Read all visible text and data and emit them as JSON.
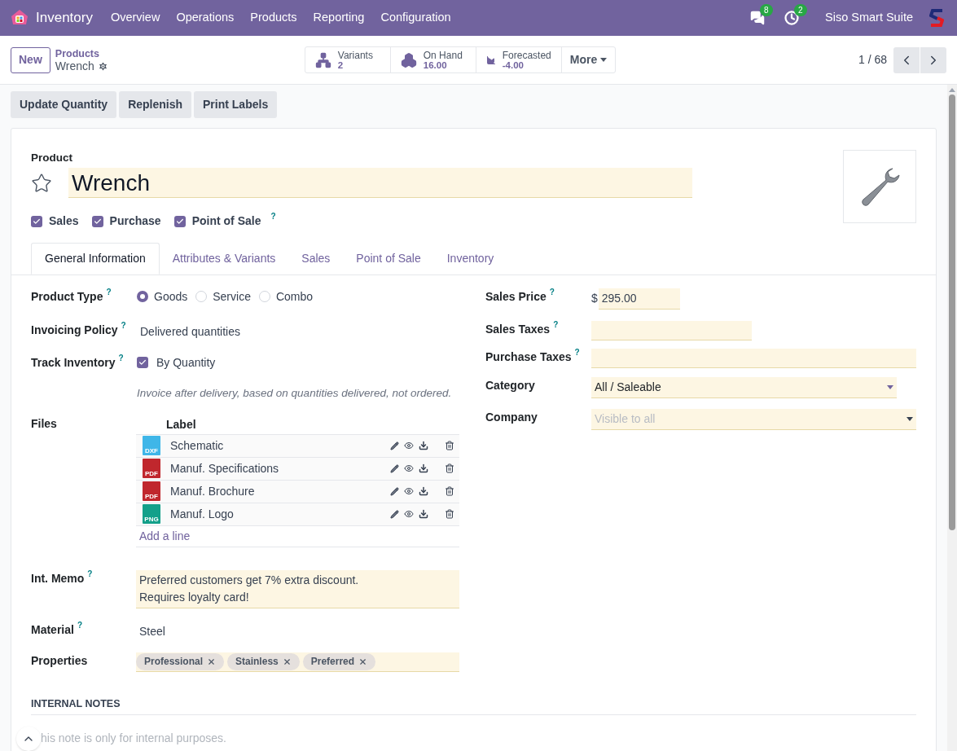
{
  "navbar": {
    "app": "Inventory",
    "menu": [
      "Overview",
      "Operations",
      "Products",
      "Reporting",
      "Configuration"
    ],
    "messages_count": "8",
    "activities_count": "2",
    "company": "Siso Smart Suite"
  },
  "control_panel": {
    "new_button": "New",
    "breadcrumb": "Products",
    "record": "Wrench",
    "smart_buttons": [
      {
        "kind": "variants",
        "label": "Variants",
        "value": "2"
      },
      {
        "kind": "stock",
        "label": "On Hand",
        "value": "16.00"
      },
      {
        "kind": "forecast",
        "label": "Forecasted",
        "value": "-4.00"
      }
    ],
    "more": "More",
    "pager": "1 / 68"
  },
  "actions": [
    "Update Quantity",
    "Replenish",
    "Print Labels"
  ],
  "form": {
    "product_label": "Product",
    "name": "Wrench",
    "favorite": false,
    "options": [
      {
        "label": "Sales",
        "checked": true,
        "help": false
      },
      {
        "label": "Purchase",
        "checked": true,
        "help": false
      },
      {
        "label": "Point of Sale",
        "checked": true,
        "help": true
      }
    ],
    "help_mark": "?",
    "tabs": [
      {
        "label": "General Information",
        "selected": true
      },
      {
        "label": "Attributes & Variants",
        "selected": false
      },
      {
        "label": "Sales",
        "selected": false
      },
      {
        "label": "Point of Sale",
        "selected": false
      },
      {
        "label": "Inventory",
        "selected": false
      }
    ],
    "product_type": {
      "label": "Product Type",
      "options": [
        {
          "label": "Goods",
          "selected": true
        },
        {
          "label": "Service",
          "selected": false
        },
        {
          "label": "Combo",
          "selected": false
        }
      ]
    },
    "invoicing_policy": {
      "label": "Invoicing Policy",
      "value": "Delivered quantities"
    },
    "track_inventory": {
      "label": "Track Inventory",
      "checked": true,
      "value": "By Quantity"
    },
    "invoice_hint": "Invoice after delivery, based on quantities delivered, not ordered.",
    "files": {
      "label": "Files",
      "column": "Label",
      "rows": [
        {
          "kind": "dxf",
          "type": "DXF",
          "name": "Schematic"
        },
        {
          "kind": "pdf",
          "type": "PDF",
          "name": "Manuf. Specifications"
        },
        {
          "kind": "pdf",
          "type": "PDF",
          "name": "Manuf. Brochure"
        },
        {
          "kind": "png",
          "type": "PNG",
          "name": "Manuf. Logo"
        }
      ],
      "add_line": "Add a line"
    },
    "int_memo": {
      "label": "Int. Memo",
      "lines": [
        "Preferred customers get 7% extra discount.",
        "Requires loyalty card!"
      ]
    },
    "material": {
      "label": "Material",
      "value": "Steel"
    },
    "properties": {
      "label": "Properties",
      "tags": [
        "Professional",
        "Stainless",
        "Preferred"
      ]
    },
    "sales_price": {
      "label": "Sales Price",
      "currency": "$",
      "value": "295.00"
    },
    "sales_taxes": {
      "label": "Sales Taxes"
    },
    "purchase_taxes": {
      "label": "Purchase Taxes"
    },
    "category": {
      "label": "Category",
      "value": "All / Saleable"
    },
    "company": {
      "label": "Company",
      "placeholder": "Visible to all"
    },
    "internal_notes": {
      "title": "INTERNAL NOTES",
      "placeholder": "his note is only for internal purposes."
    }
  }
}
